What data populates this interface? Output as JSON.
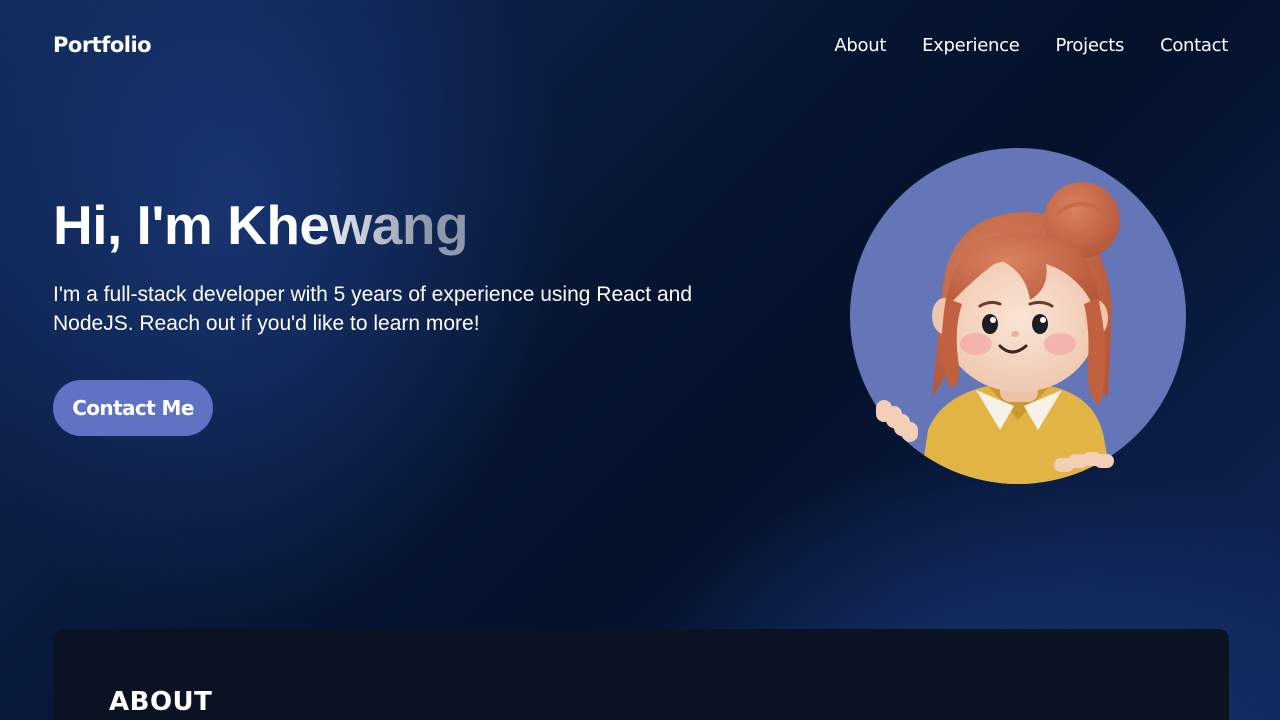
{
  "nav": {
    "brand": "Portfolio",
    "links": [
      "About",
      "Experience",
      "Projects",
      "Contact"
    ]
  },
  "hero": {
    "title": "Hi, I'm Khewang",
    "description": "I'm a full-stack developer with 5 years of experience using React and NodeJS. Reach out if you'd like to learn more!",
    "cta_label": "Contact Me"
  },
  "about": {
    "title": "ABOUT"
  },
  "icons": {
    "avatar": "avatar-illustration-icon"
  },
  "colors": {
    "background": "#0a1733",
    "accent": "#6172c5",
    "avatar_bg": "#6476b8",
    "card": "#0b1224"
  }
}
